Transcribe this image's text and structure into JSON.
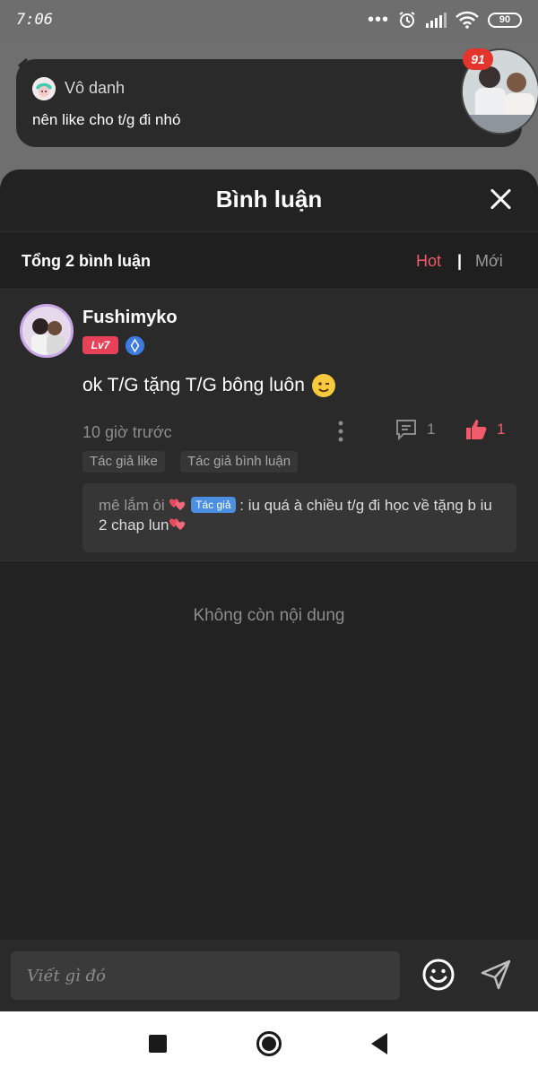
{
  "status_bar": {
    "time": "7:06",
    "battery": "90",
    "icons": [
      "dots-icon",
      "alarm-icon",
      "signal-icon",
      "wifi-icon",
      "battery-icon"
    ]
  },
  "notification": {
    "app_name": "Vô danh",
    "message": "nên like cho t/g đi nhó",
    "badge_count": "91"
  },
  "sheet": {
    "title": "Bình luận",
    "total_label": "Tổng 2 bình luận",
    "sort_hot": "Hot",
    "sort_separator": "|",
    "sort_new": "Mới",
    "accent_color": "#f05a6a"
  },
  "comment": {
    "username": "Fushimyko",
    "level": "Lv7",
    "text": "ok T/G tặng T/G bông luôn",
    "time": "10 giờ trước",
    "reply_count": "1",
    "like_count": "1",
    "tags": [
      "Tác giả like",
      "Tác giả bình luận"
    ],
    "reply": {
      "author": "mê lắm òi",
      "author_tag": "Tác giả",
      "text": ": iu quá à chiều t/g đi học về tặng b iu 2 chap lun"
    }
  },
  "no_more_text": "Không còn nội dung",
  "input": {
    "placeholder": "Viết gì đó"
  }
}
